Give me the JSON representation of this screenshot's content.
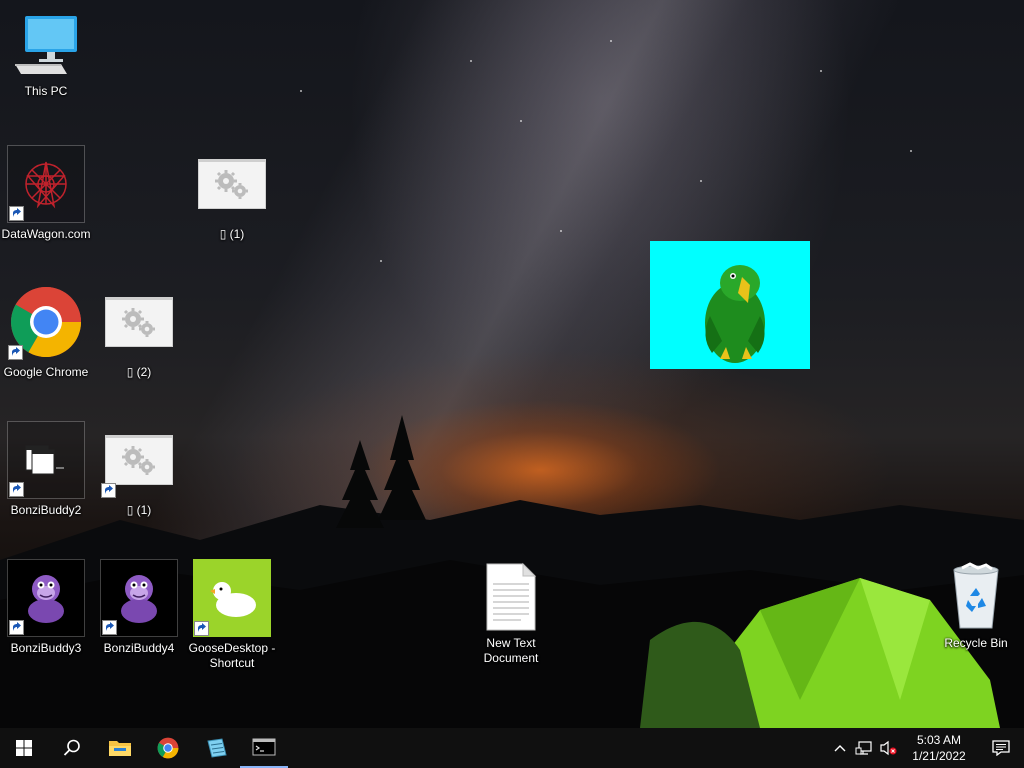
{
  "desktop": {
    "icons": {
      "this_pc": "This PC",
      "datawagon": "DataWagon.com",
      "gear_1a": "▯ (1)",
      "chrome": "Google Chrome",
      "gear_2": "▯ (2)",
      "bonzi2": "BonziBuddy2",
      "gear_1b": "▯ (1)",
      "bonzi3": "BonziBuddy3",
      "bonzi4": "BonziBuddy4",
      "goose": "GooseDesktop - Shortcut",
      "new_text": "New Text Document",
      "recycle_bin": "Recycle Bin"
    },
    "parrot_bg": "#00ffff"
  },
  "taskbar": {
    "start_icon": "windows-logo",
    "search_icon": "search",
    "pinned": [
      "file-explorer",
      "google-chrome",
      "notepad",
      "command-prompt"
    ],
    "clock": {
      "time": "5:03 AM",
      "date": "1/21/2022"
    },
    "tray": [
      "chevron-up",
      "network",
      "volume-muted",
      "notifications"
    ]
  },
  "colors": {
    "taskbar": "#101010",
    "accent": "#1a73e8"
  }
}
